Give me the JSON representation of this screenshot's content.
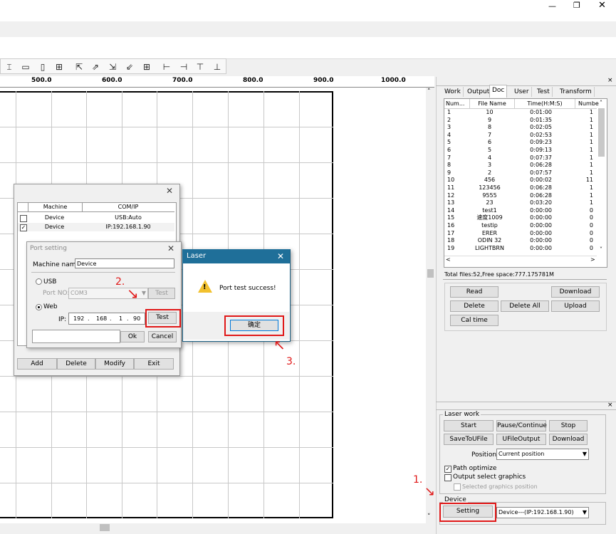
{
  "window": {
    "min_icon": "minimize-icon",
    "restore_icon": "restore-icon",
    "close_icon": "close-icon"
  },
  "ruler": {
    "labels": [
      "500.0",
      "600.0",
      "700.0",
      "800.0",
      "900.0",
      "1000.0"
    ]
  },
  "right_panel": {
    "tabs": [
      "Work",
      "Output",
      "Doc",
      "User",
      "Test",
      "Transform"
    ],
    "columns": [
      "Num...",
      "File Name",
      "Time(H:M:S)",
      "Numbe"
    ],
    "rows": [
      [
        "1",
        "10",
        "0:01:00",
        "1"
      ],
      [
        "2",
        "9",
        "0:01:35",
        "1"
      ],
      [
        "3",
        "8",
        "0:02:05",
        "1"
      ],
      [
        "4",
        "7",
        "0:02:53",
        "1"
      ],
      [
        "5",
        "6",
        "0:09:23",
        "1"
      ],
      [
        "6",
        "5",
        "0:09:13",
        "1"
      ],
      [
        "7",
        "4",
        "0:07:37",
        "1"
      ],
      [
        "8",
        "3",
        "0:06:28",
        "1"
      ],
      [
        "9",
        "2",
        "0:07:57",
        "1"
      ],
      [
        "10",
        "456",
        "0:00:02",
        "11"
      ],
      [
        "11",
        "123456",
        "0:06:28",
        "1"
      ],
      [
        "12",
        "9555",
        "0:06:28",
        "1"
      ],
      [
        "13",
        "23",
        "0:03:20",
        "1"
      ],
      [
        "14",
        "test1",
        "0:00:00",
        "0"
      ],
      [
        "15",
        "速度1009",
        "0:00:00",
        "0"
      ],
      [
        "16",
        "testip",
        "0:00:00",
        "0"
      ],
      [
        "17",
        "ERER",
        "0:00:00",
        "0"
      ],
      [
        "18",
        "ODIN 32",
        "0:00:00",
        "0"
      ],
      [
        "19",
        "LIGHTBRN",
        "0:00:00",
        "0"
      ]
    ],
    "total": "Total files:52,Free space:777.175781M",
    "buttons": {
      "read": "Read",
      "download": "Download",
      "delete": "Delete",
      "delete_all": "Delete All",
      "upload": "Upload",
      "cal_time": "Cal time"
    }
  },
  "laser_work": {
    "title": "Laser work",
    "start": "Start",
    "pause": "Pause/Continue",
    "stop": "Stop",
    "save": "SaveToUFile",
    "ufile": "UFileOutput",
    "download": "Download",
    "position_label": "Position:",
    "position_value": "Current position",
    "path_optimize": "Path optimize",
    "output_select": "Output select graphics",
    "selected_pos": "Selected graphics position"
  },
  "device": {
    "title": "Device",
    "setting": "Setting",
    "value": "Device---(IP:192.168.1.90)"
  },
  "machine_dialog": {
    "columns": [
      "Machine",
      "COM/IP"
    ],
    "rows": [
      [
        "Device",
        "USB:Auto"
      ],
      [
        "Device",
        "IP:192.168.1.90"
      ]
    ],
    "buttons": {
      "add": "Add",
      "delete": "Delete",
      "modify": "Modify",
      "exit": "Exit"
    }
  },
  "port_dialog": {
    "title": "Port setting",
    "machine_name_label": "Machine name:",
    "machine_name": "Device",
    "usb": "USB",
    "port_no_label": "Port NO:",
    "port_no": "COM3",
    "test_disabled": "Test",
    "web": "Web",
    "ip_label": "IP:",
    "ip": [
      "192",
      "168",
      "1",
      "90"
    ],
    "test": "Test",
    "ok": "Ok",
    "cancel": "Cancel"
  },
  "laser_dialog": {
    "title": "Laser",
    "message": "Port test success!",
    "ok": "确定"
  },
  "annotations": {
    "a1": "1.",
    "a2": "2.",
    "a3": "3."
  }
}
